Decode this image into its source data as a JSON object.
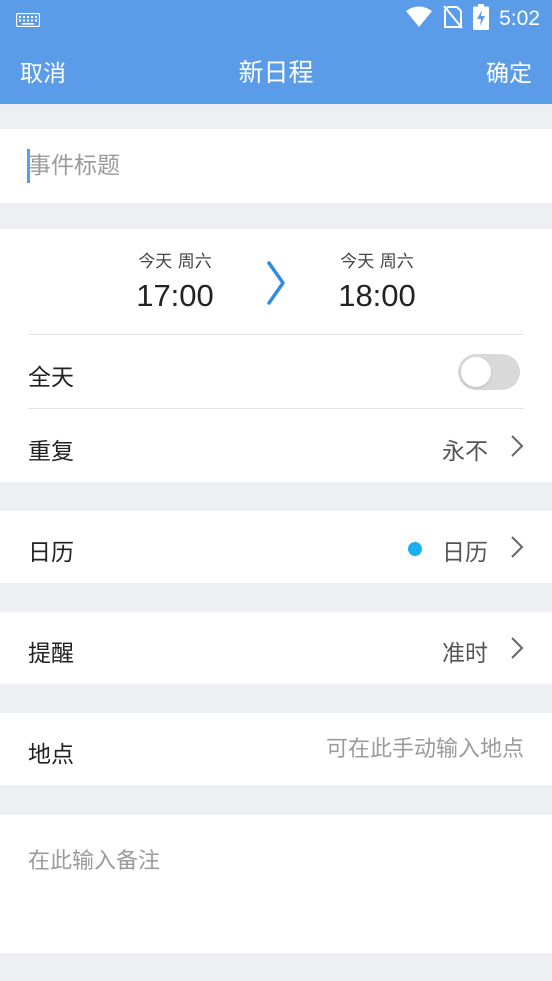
{
  "status_bar": {
    "time": "5:02",
    "icons": [
      "keyboard-icon",
      "wifi-icon",
      "no-sim-icon",
      "battery-charging-icon"
    ]
  },
  "nav": {
    "cancel_label": "取消",
    "title": "新日程",
    "confirm_label": "确定"
  },
  "event_title": {
    "value": "",
    "placeholder": "事件标题"
  },
  "time_range": {
    "start_day": "今天 周六",
    "start_time": "17:00",
    "end_day": "今天 周六",
    "end_time": "18:00"
  },
  "all_day": {
    "label": "全天",
    "enabled": false
  },
  "repeat": {
    "label": "重复",
    "value": "永不"
  },
  "calendar": {
    "label": "日历",
    "value": "日历",
    "color": "#1ab0ef"
  },
  "reminder": {
    "label": "提醒",
    "value": "准时"
  },
  "location": {
    "label": "地点",
    "value": "",
    "placeholder": "可在此手动输入地点"
  },
  "notes": {
    "value": "",
    "placeholder": "在此输入备注"
  },
  "colors": {
    "accent": "#5a9ce8",
    "background": "#eeeff3",
    "arrow": "#2f8de8"
  }
}
